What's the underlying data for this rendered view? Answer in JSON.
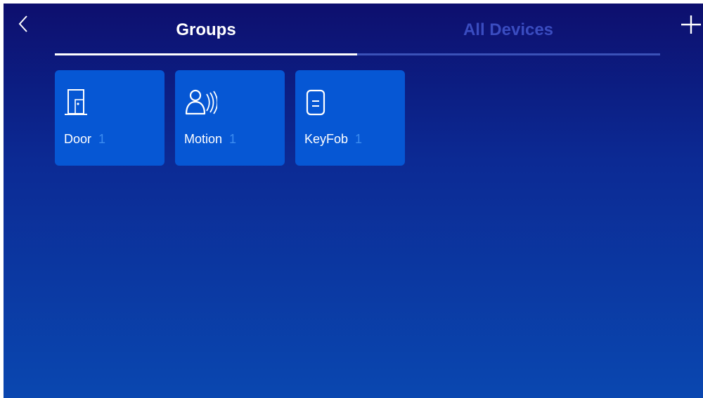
{
  "header": {
    "back_icon": "chevron-left-icon",
    "add_icon": "plus-icon"
  },
  "tabs": [
    {
      "label": "Groups",
      "active": true
    },
    {
      "label": "All Devices",
      "active": false
    }
  ],
  "groups": [
    {
      "name": "Door",
      "count": "1",
      "icon": "door-icon"
    },
    {
      "name": "Motion",
      "count": "1",
      "icon": "motion-sensor-icon"
    },
    {
      "name": "KeyFob",
      "count": "1",
      "icon": "keyfob-icon"
    }
  ],
  "colors": {
    "background_top": "#0d0f6e",
    "background_bottom": "#0a47b0",
    "card": "#0657d4",
    "count_accent": "#3c8cf0",
    "inactive_tab": "#3a4cc0"
  }
}
